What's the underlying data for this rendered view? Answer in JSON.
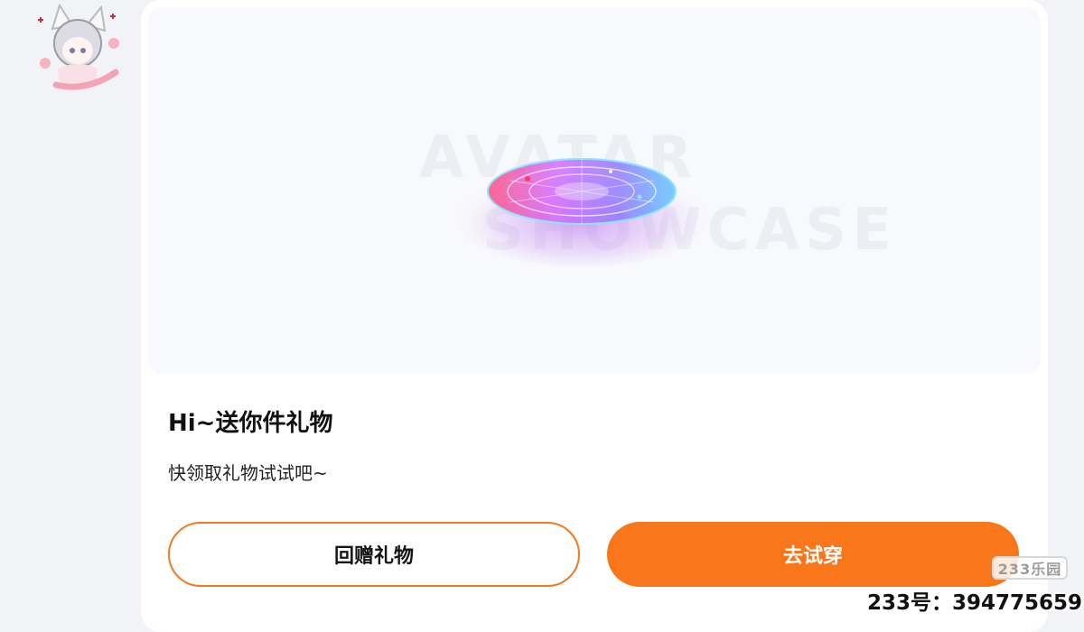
{
  "gift_card": {
    "title": "Hi~送你件礼物",
    "subtitle": "快领取礼物试试吧~",
    "preview": {
      "watermark_top": "AVATAR",
      "watermark_bottom": "SHOWCASE"
    },
    "buttons": {
      "return_gift": "回赠礼物",
      "try_on": "去试穿"
    }
  },
  "overlay": {
    "badge": "233乐园",
    "site_id": "233号：394775659"
  },
  "colors": {
    "accent": "#f9761a",
    "outline": "#f07a21",
    "background": "#f2f3f6"
  },
  "icons": {
    "avatar": "anime-girl-avatar-sticker",
    "platform": "magic-circle-platform"
  }
}
